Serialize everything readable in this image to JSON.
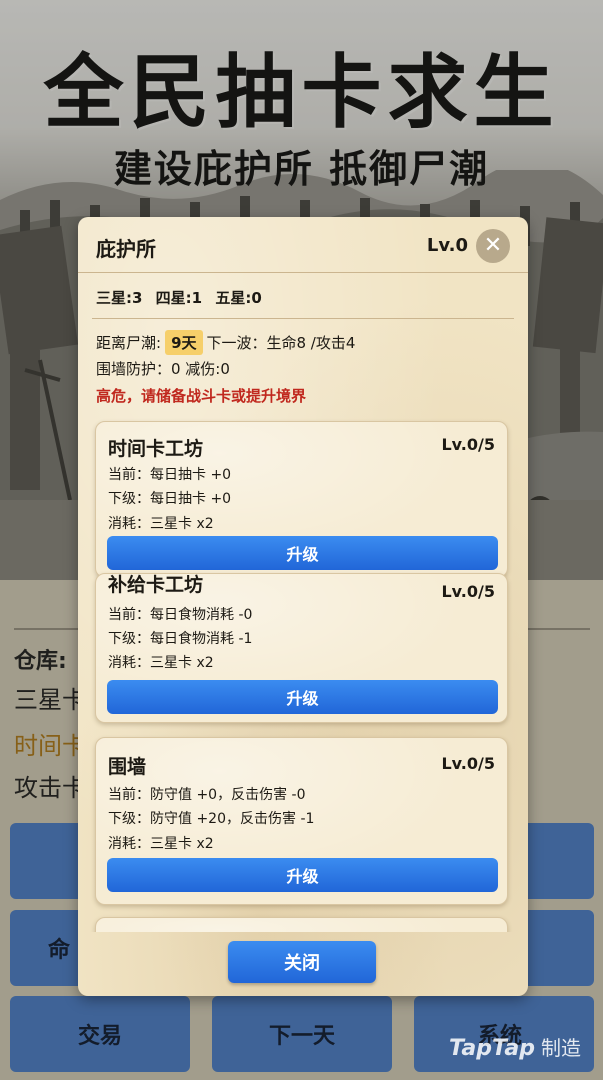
{
  "poster": {
    "title": "全民抽卡求生",
    "subtitle": "建设庇护所 抵御尸潮"
  },
  "background": {
    "storage_label": "仓库:",
    "line_star3": "三星卡",
    "line_time": "时间卡",
    "line_attack": "攻击卡",
    "buttons": {
      "life": "命",
      "trade": "交易",
      "next_day": "下一天",
      "system": "系统"
    },
    "watermark": "TapTap",
    "watermark_suffix": "制造"
  },
  "modal": {
    "title": "庇护所",
    "level": "Lv.0",
    "close_glyph": "✕",
    "stars": {
      "three": "三星:3",
      "four": "四星:1",
      "five": "五星:0"
    },
    "zombie_label": "距离尸潮:",
    "zombie_days": "9天",
    "next_wave": "下一波：生命8 /攻击4",
    "wall_defense": "围墙防护：0  减伤:0",
    "warning": "高危，请储备战斗卡或提升境界",
    "cards": [
      {
        "name": "时间卡工坊",
        "level": "Lv.0/5",
        "current": "当前：每日抽卡 +0",
        "next": "下级：每日抽卡 +0",
        "cost": "消耗：三星卡 x2",
        "button": "升级"
      },
      {
        "name": "补给卡工坊",
        "level": "Lv.0/5",
        "current": "当前：每日食物消耗 -0",
        "next": "下级：每日食物消耗 -1",
        "cost": "消耗：三星卡 x2",
        "button": "升级"
      },
      {
        "name": "围墙",
        "level": "Lv.0/5",
        "current": "当前：防守值 +0，反击伤害 -0",
        "next": "下级：防守值 +20，反击伤害 -1",
        "cost": "消耗：三星卡 x2",
        "button": "升级"
      }
    ],
    "close_button": "关闭"
  },
  "colors": {
    "primary_button": "#2c79e6",
    "warning_text": "#c0281e",
    "highlight_badge": "#f6cf6a",
    "parchment": "#f1e4c4"
  }
}
